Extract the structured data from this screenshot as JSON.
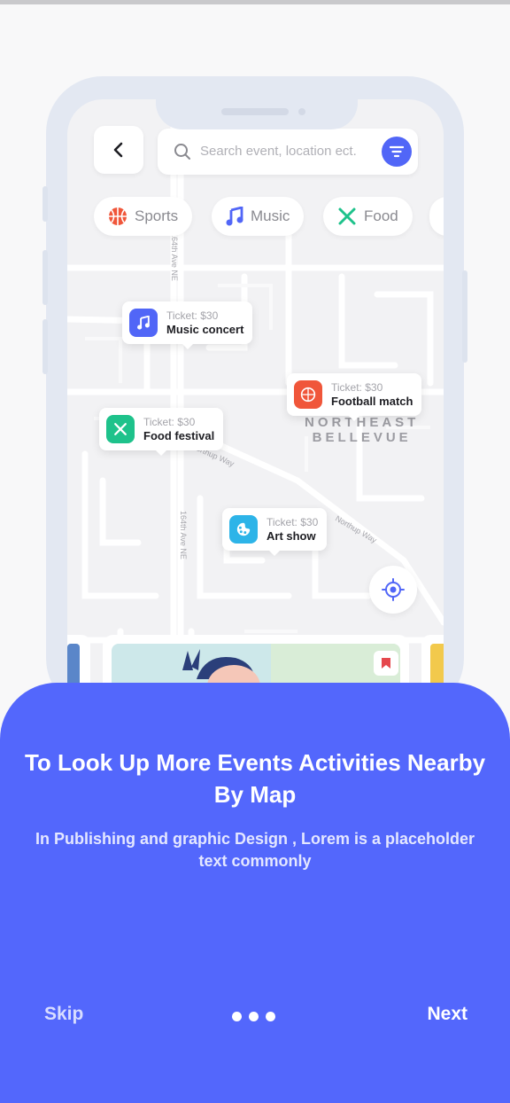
{
  "search": {
    "back_icon": "chevron-left-icon",
    "placeholder": "Search event, location ect.",
    "filter_icon": "filter-icon"
  },
  "categories": [
    {
      "label": "Sports",
      "icon": "basketball-icon",
      "color": "#f0563a"
    },
    {
      "label": "Music",
      "icon": "music-note-icon",
      "color": "#5166f7"
    },
    {
      "label": "Food",
      "icon": "utensils-icon",
      "color": "#1ec28b"
    }
  ],
  "map": {
    "street_labels": [
      "164th Ave NE",
      "Northup Way",
      "164th Ave NE",
      "Northup Way"
    ],
    "area_label_line1": "NORTHEAST",
    "area_label_line2": "BELLEVUE"
  },
  "markers": [
    {
      "price": "Ticket: $30",
      "title": "Music concert",
      "color": "#5166f7",
      "icon": "music-note-icon"
    },
    {
      "price": "Ticket: $30",
      "title": "Football match",
      "color": "#f0563a",
      "icon": "basketball-icon"
    },
    {
      "price": "Ticket: $30",
      "title": "Food festival",
      "color": "#1ec28b",
      "icon": "utensils-icon"
    },
    {
      "price": "Ticket: $30",
      "title": "Art show",
      "color": "#2db4e8",
      "icon": "palette-icon"
    }
  ],
  "onboarding": {
    "headline": "To Look Up More Events Activities Nearby By Map",
    "subtitle": "In Publishing and graphic Design , Lorem is a placeholder text commonly",
    "skip_label": "Skip",
    "next_label": "Next",
    "page_count": 3,
    "accent_color": "#5367fc"
  }
}
